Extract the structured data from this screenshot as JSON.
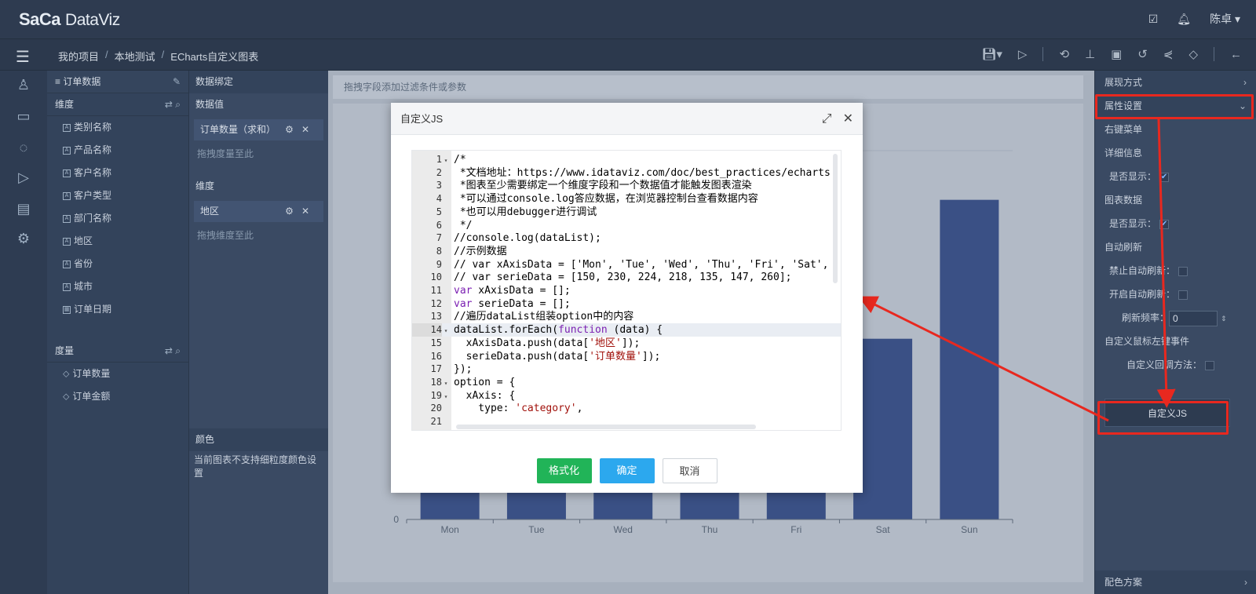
{
  "app": {
    "logo": "SaCa",
    "product": "DataViz",
    "user": "陈卓"
  },
  "breadcrumb": [
    "我的项目",
    "本地测试",
    "ECharts自定义图表"
  ],
  "fields_panel": {
    "title": "订单数据",
    "dimensions_label": "维度",
    "dimensions": [
      "类别名称",
      "产品名称",
      "客户名称",
      "客户类型",
      "部门名称",
      "地区",
      "省份",
      "城市",
      "订单日期"
    ],
    "measures_label": "度量",
    "measures": [
      "订单数量",
      "订单金额"
    ]
  },
  "binding_panel": {
    "title": "数据绑定",
    "values_label": "数据值",
    "value_item": "订单数量（求和）",
    "value_hint": "拖拽度量至此",
    "dims_label": "维度",
    "dim_item": "地区",
    "dim_hint": "拖拽维度至此",
    "color_label": "颜色",
    "color_note": "当前图表不支持细粒度颜色设置"
  },
  "canvas": {
    "filter_hint": "拖拽字段添加过滤条件或参数"
  },
  "chart_data": {
    "type": "bar",
    "categories": [
      "Mon",
      "Tue",
      "Wed",
      "Thu",
      "Fri",
      "Sat",
      "Sun"
    ],
    "values": [
      150,
      230,
      224,
      218,
      135,
      147,
      260
    ],
    "ylim": [
      0,
      300
    ],
    "y_tick_label": "0",
    "bar_color": "#3a5085"
  },
  "props_panel": {
    "display_mode": "展现方式",
    "attr_settings": "属性设置",
    "context_menu": "右键菜单",
    "detail_info": "详细信息",
    "show_label": "是否显示：",
    "chart_data_label": "图表数据",
    "show_label2": "是否显示：",
    "auto_refresh": "自动刷新",
    "disable_refresh": "禁止自动刷新：",
    "enable_refresh": "开启自动刷新：",
    "refresh_rate": "刷新频率：",
    "refresh_value": "0",
    "custom_click": "自定义鼠标左键事件",
    "custom_callback": "自定义回调方法：",
    "custom_js_button": "自定义JS",
    "color_scheme": "配色方案"
  },
  "dialog": {
    "title": "自定义JS",
    "code_lines": [
      "/*",
      " *文档地址：https://www.idataviz.com/doc/best_practices/echarts",
      " *图表至少需要绑定一个维度字段和一个数据值才能触发图表渲染",
      " *可以通过console.log答应数据，在浏览器控制台查看数据内容",
      " *也可以用debugger进行调试",
      " */",
      "//console.log(dataList);",
      "//示例数据",
      "// var xAxisData = ['Mon', 'Tue', 'Wed', 'Thu', 'Fri', 'Sat',",
      "// var serieData = [150, 230, 224, 218, 135, 147, 260];",
      "var xAxisData = [];",
      "var serieData = [];",
      "//遍历dataList组装option中的内容",
      "dataList.forEach(function (data) {",
      "  xAxisData.push(data['地区']);",
      "  serieData.push(data['订单数量']);",
      "});",
      "option = {",
      "  xAxis: {",
      "    type: 'category',",
      ""
    ],
    "format_button": "格式化",
    "ok_button": "确定",
    "cancel_button": "取消"
  }
}
